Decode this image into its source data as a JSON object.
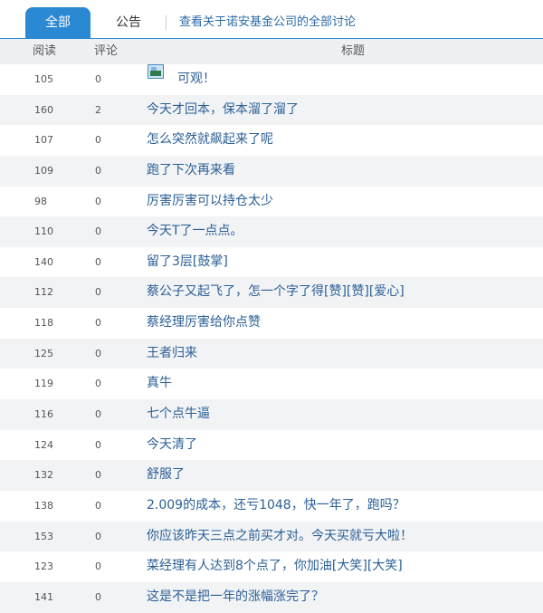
{
  "tabs": {
    "all_label": "全部",
    "notice_label": "公告",
    "link_label": "查看关于诺安基金公司的全部讨论"
  },
  "columns": {
    "read": "阅读",
    "comment": "评论",
    "title": "标题"
  },
  "rows": [
    {
      "read": "105",
      "comment": "0",
      "title": "可观！",
      "has_image": true
    },
    {
      "read": "160",
      "comment": "2",
      "title": "今天才回本，保本溜了溜了"
    },
    {
      "read": "107",
      "comment": "0",
      "title": "怎么突然就飙起来了呢"
    },
    {
      "read": "109",
      "comment": "0",
      "title": "跑了下次再来看"
    },
    {
      "read": "98",
      "comment": "0",
      "title": "厉害厉害可以持仓太少"
    },
    {
      "read": "110",
      "comment": "0",
      "title": "今天T了一点点。"
    },
    {
      "read": "140",
      "comment": "0",
      "title": "留了3层[鼓掌]"
    },
    {
      "read": "112",
      "comment": "0",
      "title": "蔡公子又起飞了，怎一个字了得[赞][赞][爱心]"
    },
    {
      "read": "118",
      "comment": "0",
      "title": "蔡经理厉害给你点赞"
    },
    {
      "read": "125",
      "comment": "0",
      "title": "王者归来"
    },
    {
      "read": "119",
      "comment": "0",
      "title": "真牛"
    },
    {
      "read": "116",
      "comment": "0",
      "title": "七个点牛逼"
    },
    {
      "read": "124",
      "comment": "0",
      "title": "今天清了"
    },
    {
      "read": "132",
      "comment": "0",
      "title": "舒服了"
    },
    {
      "read": "138",
      "comment": "0",
      "title": "2.009的成本，还亏1048，快一年了，跑吗？"
    },
    {
      "read": "153",
      "comment": "0",
      "title": "你应该昨天三点之前买才对。今天买就亏大啦！"
    },
    {
      "read": "123",
      "comment": "0",
      "title": "菜经理有人达到8个点了，你加油[大笑][大笑]"
    },
    {
      "read": "141",
      "comment": "0",
      "title": "这是不是把一年的涨幅涨完了？"
    }
  ],
  "icons": {
    "image_attachment": "image-icon"
  },
  "colors": {
    "accent": "#2b89d3",
    "link": "#2b5f96",
    "stripe": "#f2f3f5"
  }
}
